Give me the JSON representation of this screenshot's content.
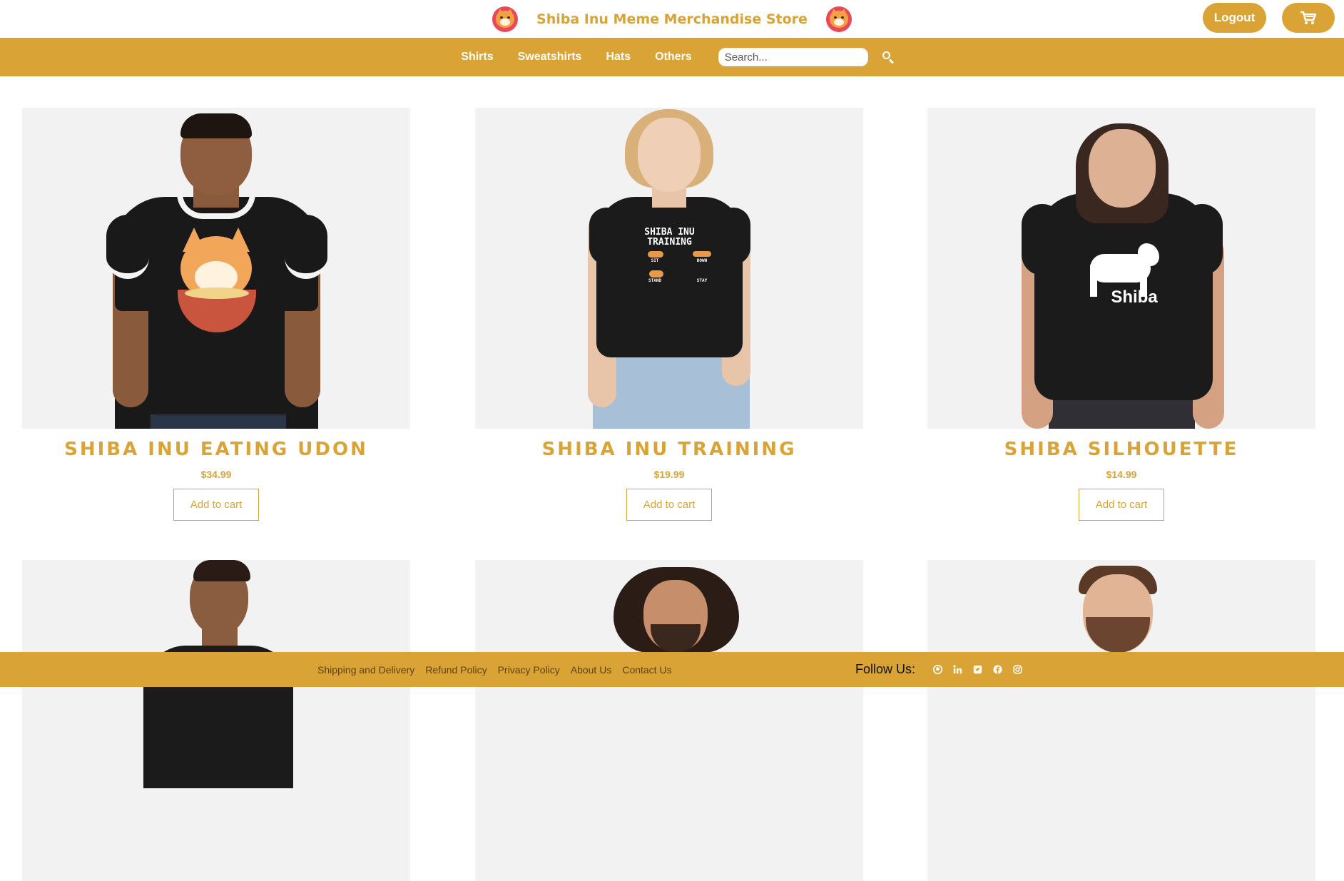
{
  "header": {
    "title": "Shiba Inu Meme Merchandise Store",
    "logout_label": "Logout",
    "cart_icon": "cart-icon"
  },
  "nav": {
    "items": [
      {
        "label": "Shirts"
      },
      {
        "label": "Sweatshirts"
      },
      {
        "label": "Hats"
      },
      {
        "label": "Others"
      }
    ],
    "search_placeholder": "Search...",
    "search_icon": "search-icon"
  },
  "products": [
    {
      "title": "SHIBA INU EATING UDON",
      "price": "$34.99",
      "button": "Add to cart"
    },
    {
      "title": "SHIBA INU TRAINING",
      "price": "$19.99",
      "button": "Add to cart"
    },
    {
      "title": "SHIBA SILHOUETTE",
      "price": "$14.99",
      "button": "Add to cart"
    }
  ],
  "prints": {
    "training_line1": "SHIBA INU",
    "training_line2": "TRAINING",
    "training_sit": "SIT",
    "training_down": "DOWN",
    "training_stand": "STAND",
    "training_stay": "STAY",
    "silhouette_word": "Shiba"
  },
  "footer": {
    "links": [
      {
        "label": "Shipping and Delivery"
      },
      {
        "label": "Refund Policy"
      },
      {
        "label": "Privacy Policy"
      },
      {
        "label": "About Us"
      },
      {
        "label": "Contact Us"
      }
    ],
    "follow_label": "Follow Us:",
    "social_icons": [
      "github-icon",
      "linkedin-icon",
      "twitter-icon",
      "facebook-icon",
      "instagram-icon"
    ]
  },
  "colors": {
    "accent": "#d9a335",
    "card_bg": "#f2f2f2",
    "shirt": "#1b1b1b"
  }
}
